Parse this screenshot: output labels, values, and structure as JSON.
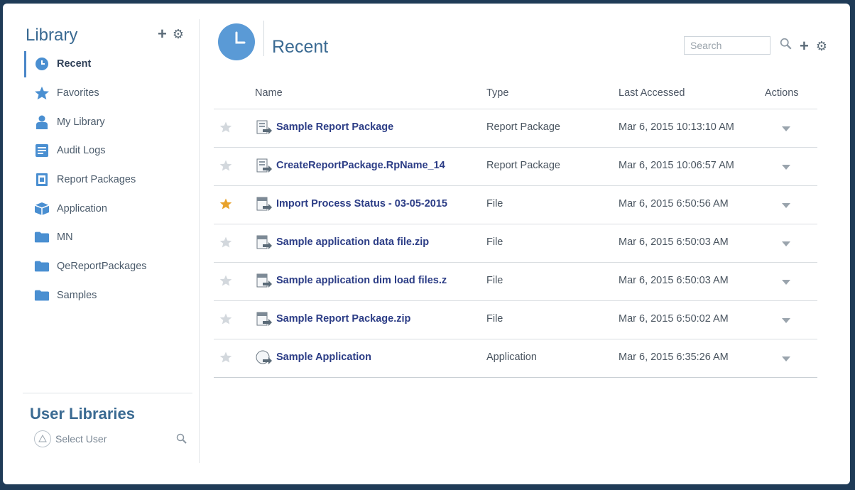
{
  "sidebar": {
    "title": "Library",
    "items": [
      {
        "label": "Recent",
        "icon": "clock-icon"
      },
      {
        "label": "Favorites",
        "icon": "star-icon"
      },
      {
        "label": "My Library",
        "icon": "user-icon"
      },
      {
        "label": "Audit Logs",
        "icon": "log-icon"
      },
      {
        "label": "Report Packages",
        "icon": "report-package-icon"
      },
      {
        "label": "Application",
        "icon": "cube-icon"
      },
      {
        "label": "MN",
        "icon": "folder-icon"
      },
      {
        "label": "QeReportPackages",
        "icon": "folder-icon"
      },
      {
        "label": "Samples",
        "icon": "folder-icon"
      }
    ],
    "user_libraries_title": "User Libraries",
    "select_user_label": "Select User"
  },
  "main": {
    "title": "Recent",
    "search_placeholder": "Search",
    "columns": {
      "name": "Name",
      "type": "Type",
      "last_accessed": "Last Accessed",
      "actions": "Actions"
    },
    "rows": [
      {
        "name": "Sample Report Package",
        "type": "Report Package",
        "last_accessed": "Mar 6, 2015 10:13:10 AM",
        "favorite": false,
        "icon": "report-package-icon"
      },
      {
        "name": "CreateReportPackage.RpName_14",
        "type": "Report Package",
        "last_accessed": "Mar 6, 2015 10:06:57 AM",
        "favorite": false,
        "icon": "report-package-icon"
      },
      {
        "name": "Import Process Status - 03-05-2015",
        "type": "File",
        "last_accessed": "Mar 6, 2015 6:50:56 AM",
        "favorite": true,
        "icon": "file-icon"
      },
      {
        "name": "Sample application data file.zip",
        "type": "File",
        "last_accessed": "Mar 6, 2015 6:50:03 AM",
        "favorite": false,
        "icon": "file-icon"
      },
      {
        "name": "Sample application dim load files.z",
        "type": "File",
        "last_accessed": "Mar 6, 2015 6:50:03 AM",
        "favorite": false,
        "icon": "file-icon"
      },
      {
        "name": "Sample Report Package.zip",
        "type": "File",
        "last_accessed": "Mar 6, 2015 6:50:02 AM",
        "favorite": false,
        "icon": "file-icon"
      },
      {
        "name": "Sample Application",
        "type": "Application",
        "last_accessed": "Mar 6, 2015 6:35:26 AM",
        "favorite": false,
        "icon": "application-icon"
      }
    ]
  },
  "colors": {
    "accent": "#4a86c8",
    "title": "#3a6a92",
    "link": "#2c3d86",
    "favorite": "#e8a22b",
    "frame": "#1f3b57"
  }
}
